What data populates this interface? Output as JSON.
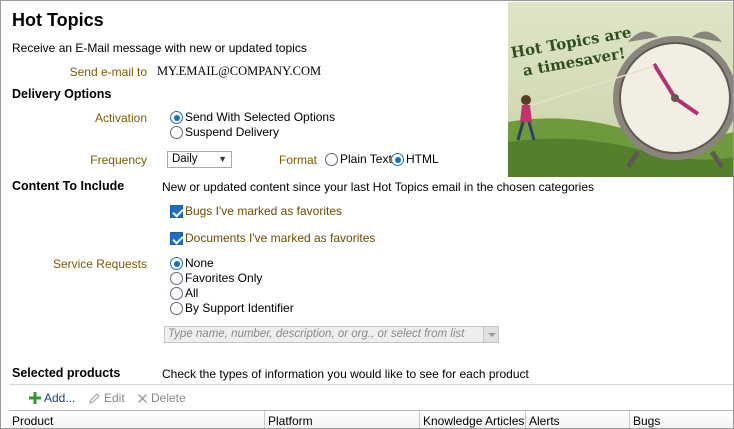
{
  "header": {
    "title": "Hot Topics",
    "subtitle": "Receive an E-Mail message with new or updated topics"
  },
  "email": {
    "label": "Send e-mail to",
    "value": "MY.EMAIL@COMPANY.COM"
  },
  "delivery": {
    "heading": "Delivery Options",
    "activation_label": "Activation",
    "activation_options": [
      "Send With Selected Options",
      "Suspend Delivery"
    ],
    "activation_selected": 0,
    "frequency_label": "Frequency",
    "frequency_value": "Daily",
    "format_label": "Format",
    "format_options": [
      "Plain Text",
      "HTML"
    ],
    "format_selected": 1
  },
  "content": {
    "heading": "Content To Include",
    "description": "New or updated content since your last Hot Topics email in the chosen categories",
    "checkbox_bugs": "Bugs I've marked as favorites",
    "checkbox_documents": "Documents I've marked as favorites",
    "bugs_checked": true,
    "documents_checked": true,
    "service_requests_label": "Service Requests",
    "service_options": [
      "None",
      "Favorites Only",
      "All",
      "By Support Identifier"
    ],
    "service_selected": 0,
    "identifier_placeholder": "Type name, number, description, or org., or select from list"
  },
  "hero": {
    "text_line1": "Hot Topics are",
    "text_line2": "a timesaver!"
  },
  "products": {
    "heading": "Selected products",
    "description": "Check the types of information you would like to see for each product",
    "toolbar": {
      "add_label": "Add...",
      "edit_label": "Edit",
      "delete_label": "Delete"
    },
    "columns": [
      "Product",
      "Platform",
      "Knowledge Articles",
      "Alerts",
      "Bugs"
    ]
  },
  "colors": {
    "label_color": "#7a5c00",
    "accent": "#1d6cc7"
  }
}
